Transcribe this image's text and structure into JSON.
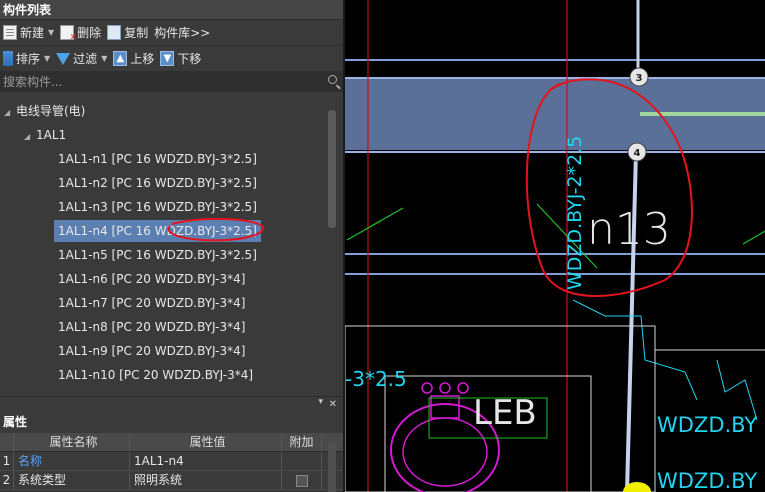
{
  "panel": {
    "title": "构件列表"
  },
  "toolbar1": {
    "new_label": "新建",
    "delete_label": "删除",
    "copy_label": "复制",
    "library_label": "构件库>>"
  },
  "toolbar2": {
    "sort_label": "排序",
    "filter_label": "过滤",
    "up_label": "上移",
    "down_label": "下移"
  },
  "search": {
    "placeholder": "搜索构件..."
  },
  "tree": {
    "root": "电线导管(电)",
    "group": "1AL1",
    "items": [
      "1AL1-n1 [PC 16 WDZD.BYJ-3*2.5]",
      "1AL1-n2 [PC 16 WDZD.BYJ-3*2.5]",
      "1AL1-n3 [PC 16 WDZD.BYJ-3*2.5]",
      "1AL1-n4 [PC 16 WDZD.BYJ-3*2.5]",
      "1AL1-n5 [PC 16 WDZD.BYJ-3*2.5]",
      "1AL1-n6 [PC 20 WDZD.BYJ-3*4]",
      "1AL1-n7 [PC 20 WDZD.BYJ-3*4]",
      "1AL1-n8 [PC 20 WDZD.BYJ-3*4]",
      "1AL1-n9 [PC 20 WDZD.BYJ-3*4]",
      "1AL1-n10 [PC 20 WDZD.BYJ-3*4]"
    ],
    "selected_index": 3
  },
  "attributes": {
    "title": "属性",
    "headers": {
      "name": "属性名称",
      "value": "属性值",
      "extra": "附加"
    },
    "rows": [
      {
        "num": "1",
        "name": "名称",
        "value": "1AL1-n4"
      },
      {
        "num": "2",
        "name": "系统类型",
        "value": "照明系统"
      }
    ]
  },
  "drawing": {
    "node_labels": [
      "3",
      "4"
    ],
    "cable_vertical": "WDZD.BYJ-2*2.5",
    "circuit_label": "n13",
    "partial_spec": "-3*2.5",
    "fixture_label": "LEB",
    "right_label_1": "WDZD.BY",
    "right_label_2": "WDZD.BY",
    "colors": {
      "cyan_text": "#21d4f0",
      "annotation_red": "#e4141c",
      "steel_blue": "#7f9ed6",
      "magenta": "#d21bd0",
      "green": "#1fbf2a"
    }
  }
}
